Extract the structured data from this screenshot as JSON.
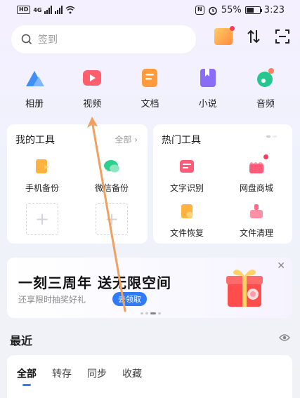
{
  "status_bar": {
    "network_badge": "HD",
    "network_type": "4G",
    "nfc_icon": "N",
    "battery_percent": "55%",
    "battery_level": 0.55,
    "time": "3:23"
  },
  "search": {
    "placeholder": "签到"
  },
  "top_icons": [
    "gift-icon",
    "transfer-icon",
    "scan-icon"
  ],
  "categories": [
    {
      "label": "相册",
      "icon": "album-icon",
      "color": "#3f8ff7"
    },
    {
      "label": "视频",
      "icon": "video-icon",
      "color": "#ff5e6c"
    },
    {
      "label": "文档",
      "icon": "document-icon",
      "color": "#ff9b3a"
    },
    {
      "label": "小说",
      "icon": "novel-icon",
      "color": "#8a6cf6"
    },
    {
      "label": "音频",
      "icon": "audio-icon",
      "color": "#24c88e"
    }
  ],
  "my_tools": {
    "title": "我的工具",
    "more_label": "全部",
    "items": [
      {
        "label": "手机备份",
        "icon": "phone-backup-icon",
        "color": "#ffb23d"
      },
      {
        "label": "微信备份",
        "icon": "wechat-backup-icon",
        "color": "#2fcf8f"
      }
    ]
  },
  "hot_tools": {
    "title": "热门工具",
    "items": [
      {
        "label": "文字识别",
        "icon": "ocr-icon",
        "color": "#ff5a78"
      },
      {
        "label": "网盘商城",
        "icon": "store-icon",
        "color": "#ff5a78"
      },
      {
        "label": "文件恢复",
        "icon": "file-recover-icon",
        "color": "#ffb23d"
      },
      {
        "label": "文件清理",
        "icon": "file-clean-icon",
        "color": "#ff6a8a"
      }
    ]
  },
  "banner": {
    "title": "一刻三周年 送无限空间",
    "subtitle": "还享限时抽奖好礼",
    "button_label": "去领取"
  },
  "recent": {
    "title": "最近",
    "tabs": [
      "全部",
      "转存",
      "同步",
      "收藏"
    ]
  },
  "accent_color": "#2f7cf6"
}
